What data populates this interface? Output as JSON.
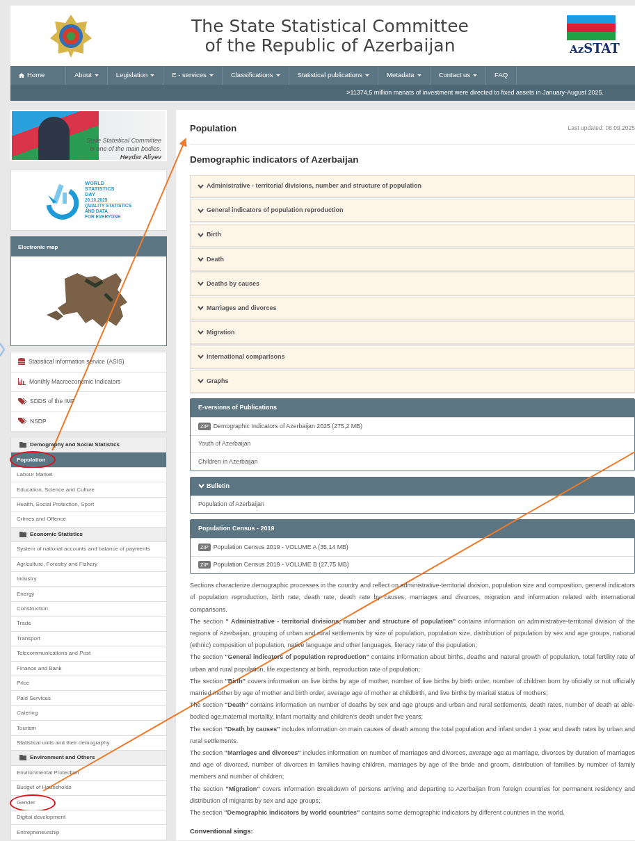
{
  "header": {
    "title_lines": [
      "The State Statistical Committee",
      "of the Republic of Azerbaijan"
    ],
    "logo_text": [
      "Az",
      "STAT"
    ]
  },
  "nav": [
    {
      "label": "Home",
      "kind": "home"
    },
    {
      "label": "About",
      "kind": "dropdown"
    },
    {
      "label": "Legislation",
      "kind": "dropdown"
    },
    {
      "label": "E - services",
      "kind": "dropdown"
    },
    {
      "label": "Classifications",
      "kind": "dropdown"
    },
    {
      "label": "Statistical publications",
      "kind": "dropdown"
    },
    {
      "label": "Metadata",
      "kind": "dropdown"
    },
    {
      "label": "Contact us",
      "kind": "dropdown"
    },
    {
      "label": "FAQ",
      "kind": "plain"
    }
  ],
  "ticker": ">11374,5 million manats of investment were directed to fixed assets in January-August 2025.",
  "sidebar": {
    "quote_banner": [
      "State Statistical Committee",
      "is one of the main bodies.",
      "Heydar Aliyev"
    ],
    "stats_day": {
      "title_lines": [
        "WORLD",
        "STATISTICS",
        "DAY"
      ],
      "date": "20.10.2025",
      "slogan_lines": [
        "QUALITY STATISTICS",
        "AND DATA",
        "FOR EVERYONE"
      ]
    },
    "map_panel": {
      "title": "Electronic map"
    },
    "links": [
      {
        "label": "Statistical information service (ASIS)",
        "kind": "database"
      },
      {
        "label": "Monthly Macroeconomic Indicators",
        "kind": "chart"
      },
      {
        "label": "SDDS of the IMF",
        "kind": "tag"
      },
      {
        "label": "NSDP",
        "kind": "tag"
      }
    ],
    "categories": [
      {
        "title": "Demography and Social Statistics",
        "items": [
          {
            "label": "Population",
            "selected": true,
            "circled": true
          },
          {
            "label": "Labour Market",
            "selected": false,
            "circled": false
          },
          {
            "label": "Education, Science and Culture",
            "selected": false,
            "circled": false
          },
          {
            "label": "Health, Social Protection, Sport",
            "selected": false,
            "circled": false
          },
          {
            "label": "Crimes and Offence",
            "selected": false,
            "circled": false
          }
        ]
      },
      {
        "title": "Economic Statistics",
        "items": [
          {
            "label": "System of national accounts and balance of payments",
            "selected": false,
            "circled": false
          },
          {
            "label": "Agriculture, Forestry and Fishery",
            "selected": false,
            "circled": false
          },
          {
            "label": "Industry",
            "selected": false,
            "circled": false
          },
          {
            "label": "Energy",
            "selected": false,
            "circled": false
          },
          {
            "label": "Construction",
            "selected": false,
            "circled": false
          },
          {
            "label": "Trade",
            "selected": false,
            "circled": false
          },
          {
            "label": "Transport",
            "selected": false,
            "circled": false
          },
          {
            "label": "Telecommunications and Post",
            "selected": false,
            "circled": false
          },
          {
            "label": "Finance and Bank",
            "selected": false,
            "circled": false
          },
          {
            "label": "Price",
            "selected": false,
            "circled": false
          },
          {
            "label": "Paid Services",
            "selected": false,
            "circled": false
          },
          {
            "label": "Catering",
            "selected": false,
            "circled": false
          },
          {
            "label": "Tourism",
            "selected": false,
            "circled": false
          },
          {
            "label": "Statistical units and their demography",
            "selected": false,
            "circled": false
          }
        ]
      },
      {
        "title": "Environment and Others",
        "items": [
          {
            "label": "Environmental Protection",
            "selected": false,
            "circled": false
          },
          {
            "label": "Budget of Households",
            "selected": false,
            "circled": false
          },
          {
            "label": "Gender",
            "selected": false,
            "circled": true
          },
          {
            "label": "Digital development",
            "selected": false,
            "circled": false
          },
          {
            "label": "Entrepreneurship",
            "selected": false,
            "circled": false
          }
        ]
      }
    ]
  },
  "main": {
    "title": "Population",
    "last_updated": "Last updated: 08.09.2025",
    "subtitle": "Demographic indicators of Azerbaijan",
    "accordion": [
      "Administrative - territorial divisions, number and structure of population",
      "General indicators of population reproduction",
      "Birth",
      "Death",
      "Deaths by causes",
      "Marriages and divorces",
      "Migration",
      "International comparisons",
      "Graphs"
    ],
    "panels": [
      {
        "title": "E-versions of Publications",
        "toggle": false,
        "items": [
          {
            "badge": "ZIP",
            "label": "Demographic Indicators of Azerbaijan 2025 (275,2 MB)"
          },
          {
            "label": "Youth of Azerbaijan"
          },
          {
            "label": "Children in Azerbaijan"
          }
        ]
      },
      {
        "title": "Bulletin",
        "toggle": true,
        "items": [
          {
            "label": "Population of Azerbaijan"
          }
        ]
      },
      {
        "title": "Population Census - 2019",
        "toggle": false,
        "items": [
          {
            "badge": "ZIP",
            "label": "Population Census 2019 - VOLUME A (35,14 MB)"
          },
          {
            "badge": "ZIP",
            "label": "Population Census 2019 - VOLUME B (27,75 MB)"
          }
        ]
      }
    ],
    "paragraphs": [
      "Sections characterize demographic processes in the country and reflect on administrative-territorial division, population size and composition, general indicators of population reproduction, birth rate, death rate, death rate by causes, marriages and divorces, migration and information related with international comparisons.",
      "The section **\" Administrative - territorial divisions, number and structure of population\"** contains information on administrative-territorial division of the regions of Azerbaijan, grouping of urban and rural settlements by size of population, population size, distribution of population by sex and age groups, national (ethnic) composition of population, native language and other languages, literacy rate of the population;",
      "The section **\"General indicators of population reproduction\"** contains information about births, deaths and natural growth of population, total fertility rate of urban and rural population, life expectancy at birth, reproduction rate of population;",
      "The section **\"Birth\"** covers information on live births by age of mother, number of live births by birth order, number of children born by oficially or not officially married mother by age of mother and birth order, average age of mother at childbirth, and live births by marital status of mothers;",
      "The section **\"Death\"** contains information on number of deaths by sex and age groups and urban and rural settlements, death rates, number of death at able-bodied age,maternal mortality, infant mortality and children's death under five years;",
      "The section **\"Death by causes\"** includes information on main causes of death among the total population and infant under 1 year and death rates by urban and rural settlements.",
      "The section **\"Marriages and divorces\"** includes information on number of marriages and divorces, average age at marriage, divorces by duration of marriages and age of divorced, number of divorces in families having children, marriages by age of the bride and groom, distribution of families by number of family members and number of children;",
      "The section **\"Migration\"** covers information Breakdown of persons arriving and departing to Azerbaijan from foreign countries for permanent residency and distribution of migrants by sex and age groups;",
      "The section **\"Demographic indicators by world countries\"** contains some demographic indicators by different countries in the world."
    ],
    "signs_title": "Conventional sings:"
  }
}
